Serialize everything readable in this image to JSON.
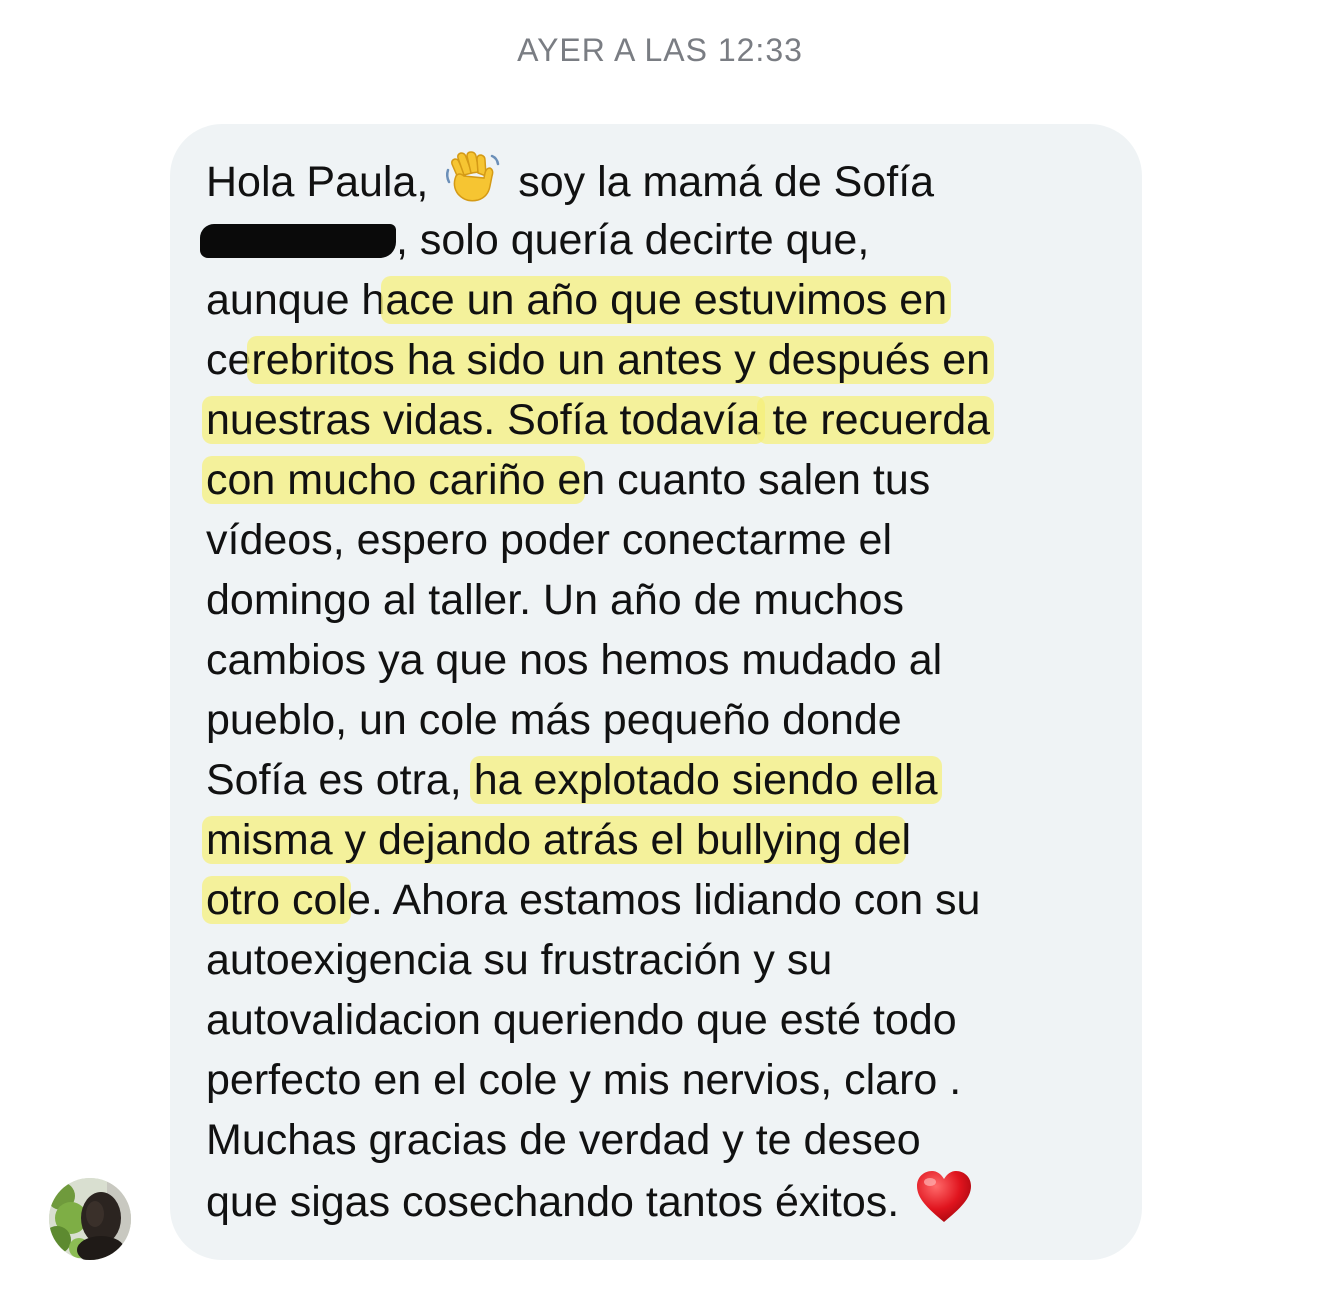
{
  "header": {
    "timestamp": "AYER A LAS 12:33"
  },
  "message": {
    "sender_avatar_icon": "avatar-photo",
    "icons": {
      "waving-hand": "waving-hand-icon",
      "heart": "red-heart-icon"
    },
    "highlight_color": "#f5f078",
    "bubble_color": "#eff3f5",
    "lines": [
      [
        "Hola Paula, ",
        " soy la mamá de Sofía"
      ],
      [
        ", solo quería decirte que,"
      ],
      [
        "aunque h",
        "ace un año que estuvimos en"
      ],
      [
        "ce",
        "rebritos ha sido un antes y después en"
      ],
      [
        "nuestras vidas. Sofía todavía",
        " te recuerda"
      ],
      [
        "con mucho cariño e",
        "n cuanto salen tus"
      ],
      [
        "vídeos, espero poder conectarme el"
      ],
      [
        "domingo al taller. Un año de muchos"
      ],
      [
        "cambios ya que nos hemos mudado al"
      ],
      [
        "pueblo, un cole más pequeño donde"
      ],
      [
        "Sofía es otra, ",
        "ha explotado siendo ella"
      ],
      [
        "misma y dejando atrás el bullying de",
        "l"
      ],
      [
        "otro col",
        "e. Ahora estamos lidiando con su"
      ],
      [
        "autoexigencia su frustración y su"
      ],
      [
        "autovalidacion queriendo que esté todo"
      ],
      [
        "perfecto en el cole y mis nervios, claro ."
      ],
      [
        "Muchas gracias de verdad y te deseo"
      ],
      [
        "que sigas cosechando tantos éxitos. "
      ]
    ]
  }
}
